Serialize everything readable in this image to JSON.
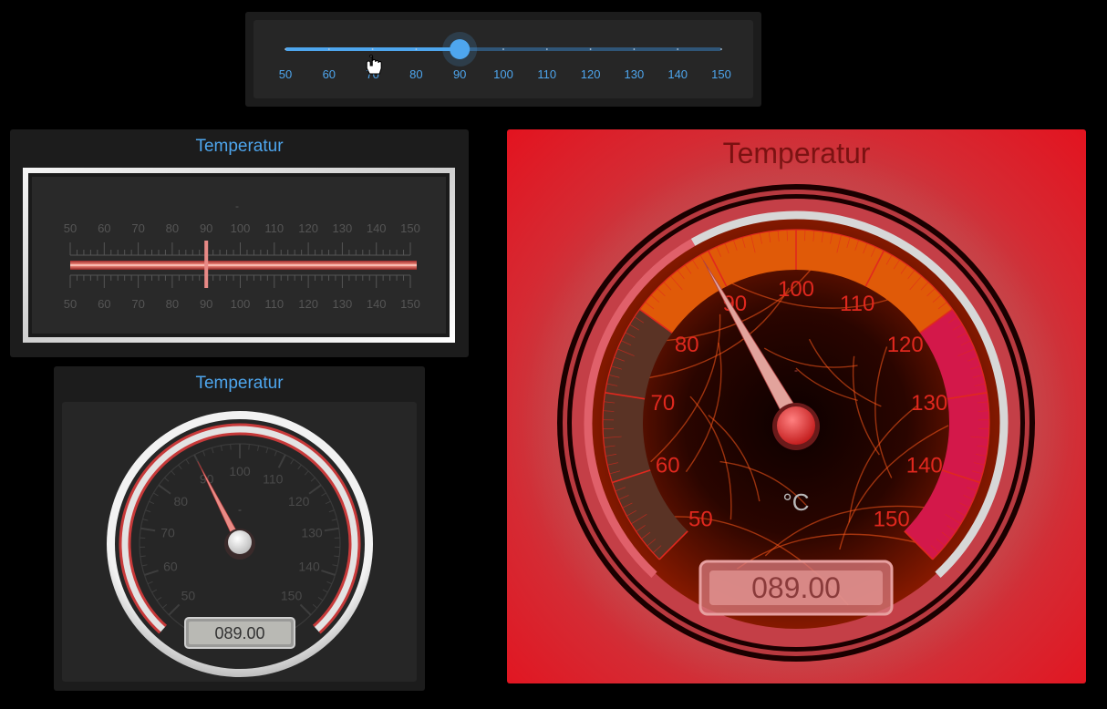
{
  "slider": {
    "min": 50,
    "max": 150,
    "value": 90,
    "ticks": [
      "50",
      "60",
      "70",
      "80",
      "90",
      "100",
      "110",
      "120",
      "130",
      "140",
      "150"
    ],
    "accent": "#4ea6ee"
  },
  "linear_gauge": {
    "title": "Temperatur",
    "unit": "-",
    "min": 50,
    "max": 150,
    "value": 90,
    "ticks": [
      "50",
      "60",
      "70",
      "80",
      "90",
      "100",
      "110",
      "120",
      "130",
      "140",
      "150"
    ]
  },
  "radial_gauge": {
    "title": "Temperatur",
    "unit": "-",
    "min": 50,
    "max": 150,
    "value": 90,
    "readout": "089.00",
    "ticks": [
      "50",
      "60",
      "70",
      "80",
      "90",
      "100",
      "110",
      "120",
      "130",
      "140",
      "150"
    ]
  },
  "big_gauge": {
    "title": "Temperatur",
    "unit": "°C",
    "dash": "-",
    "min": 50,
    "max": 150,
    "value": 89,
    "readout": "089.00",
    "ticks": [
      "50",
      "60",
      "70",
      "80",
      "90",
      "100",
      "110",
      "120",
      "130",
      "140",
      "150"
    ],
    "colors": {
      "low": "#5a3325",
      "mid": "#e05a08",
      "high": "#d3184a",
      "label": "#e0281e"
    }
  }
}
